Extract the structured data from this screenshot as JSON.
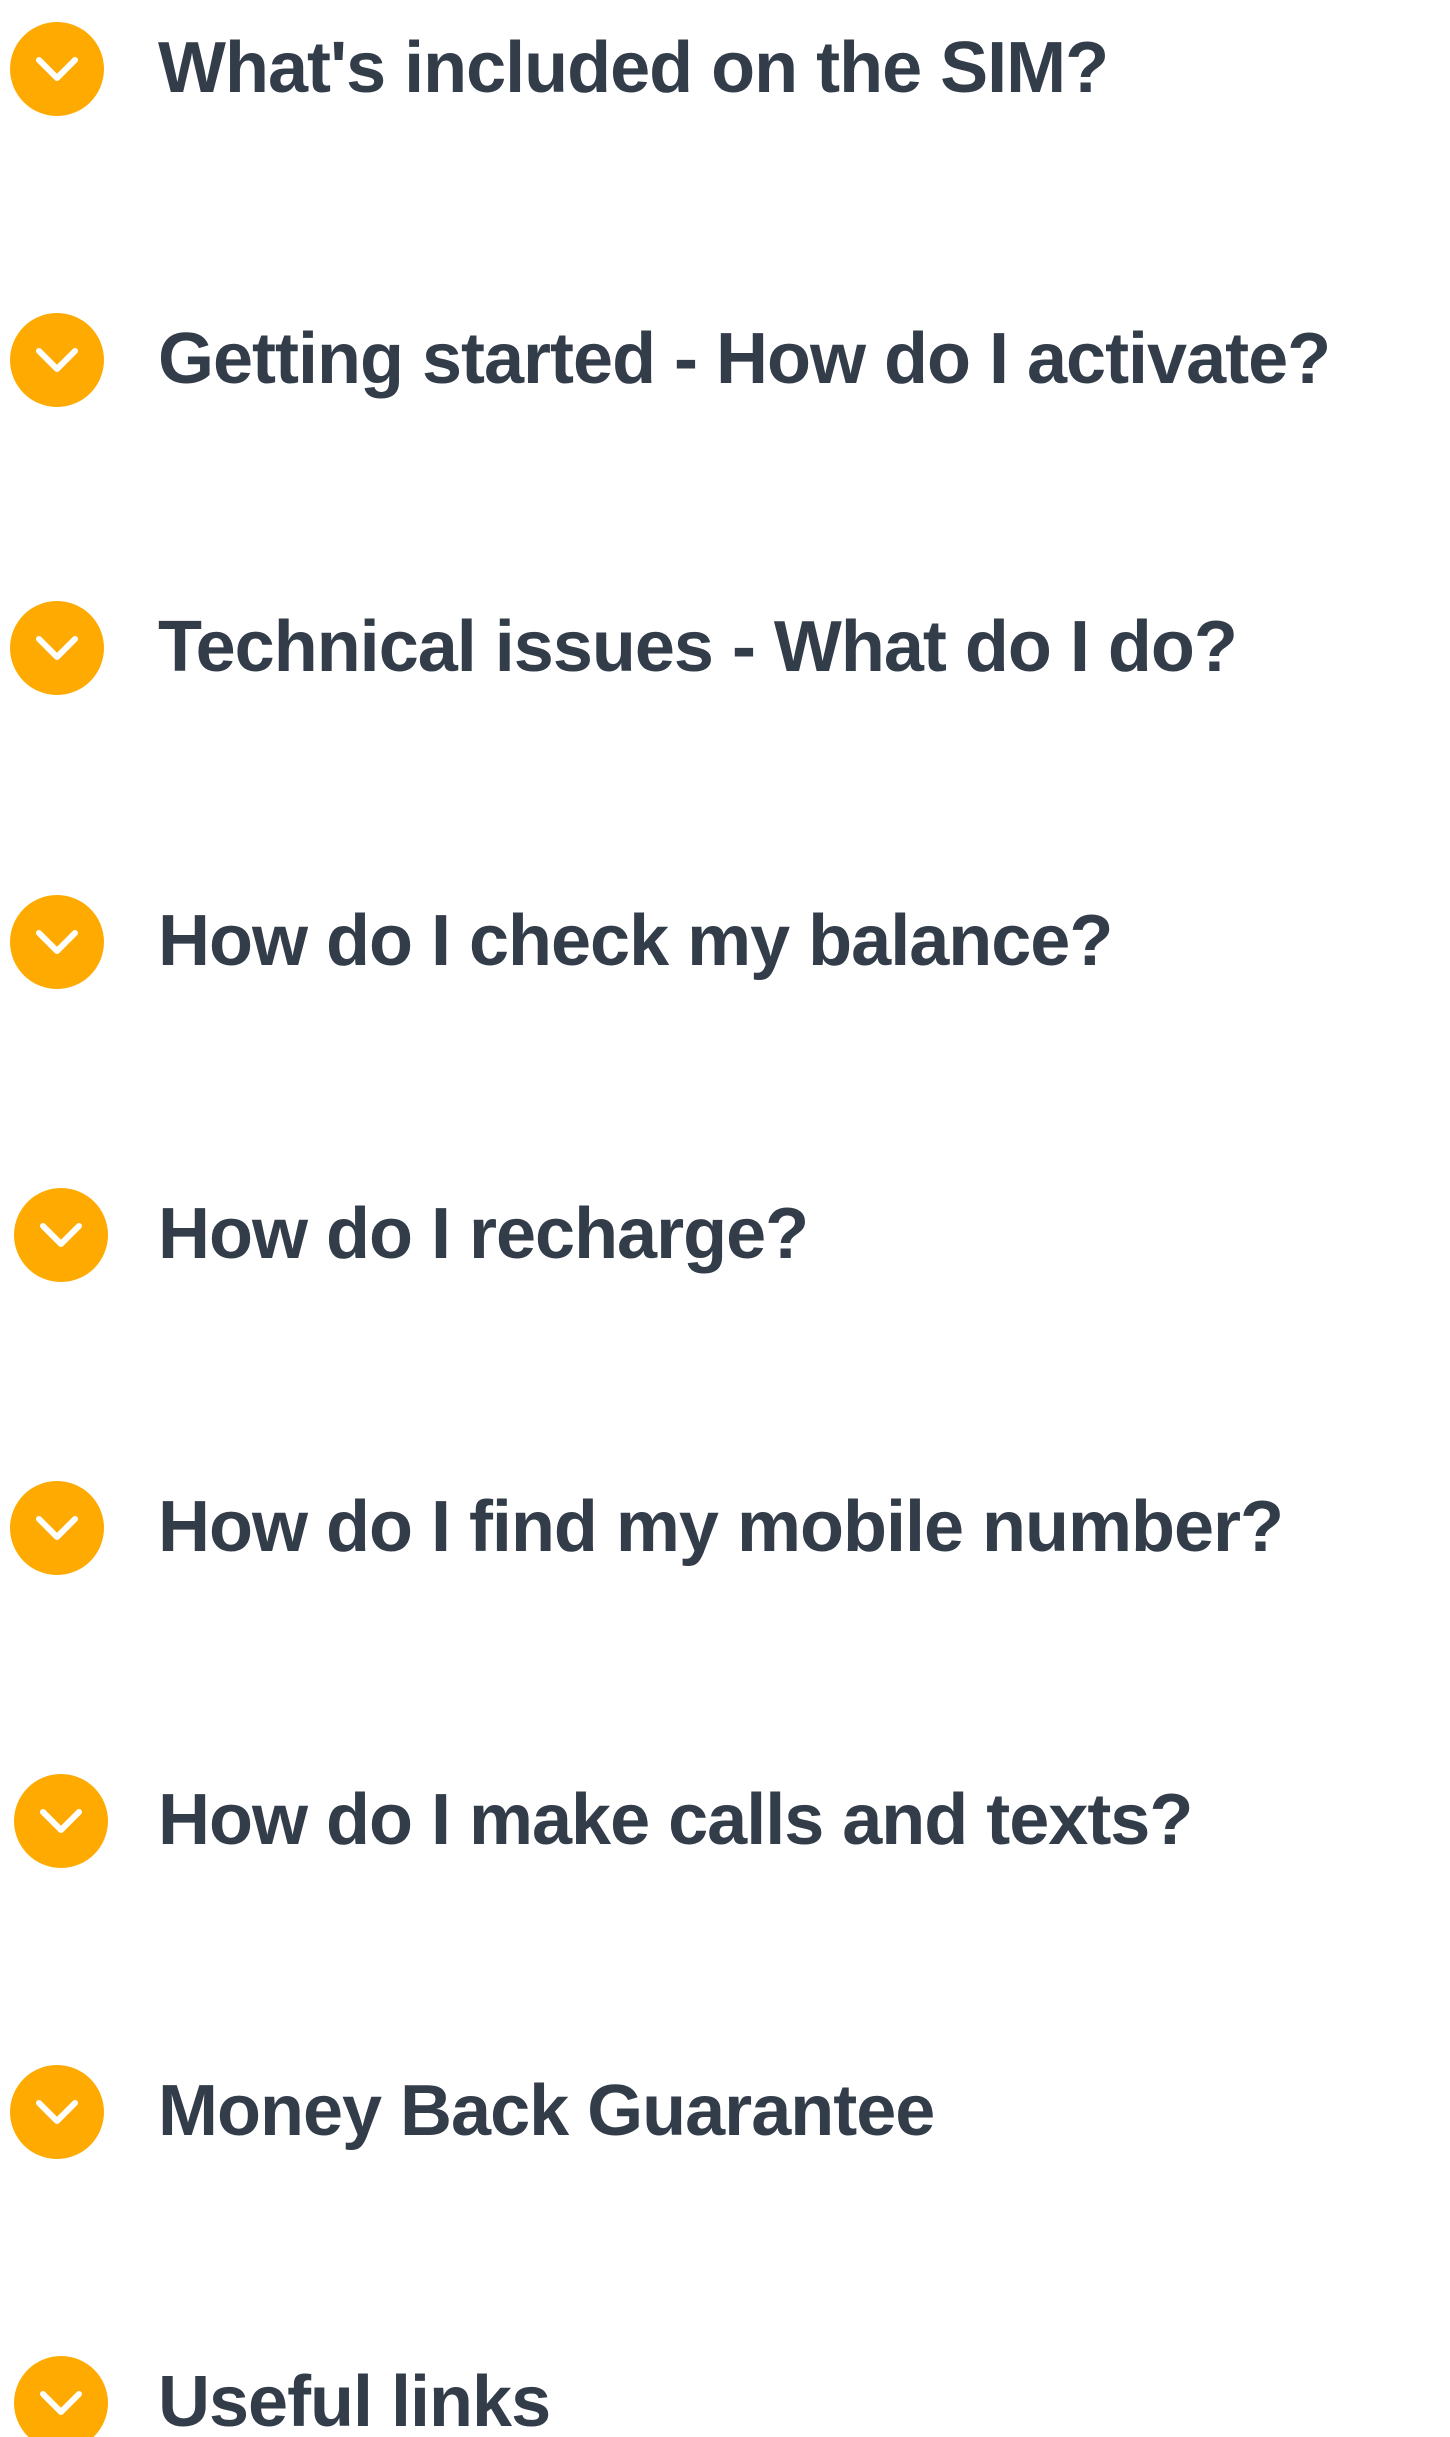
{
  "accent_color": "#FFAA00",
  "text_color": "#333D4A",
  "faq": {
    "items": [
      {
        "label": "What's included on the SIM?",
        "icon": "chevron-down-icon"
      },
      {
        "label": "Getting started - How do I activate?",
        "icon": "chevron-down-icon"
      },
      {
        "label": "Technical issues - What do I do?",
        "icon": "chevron-down-icon"
      },
      {
        "label": "How do I check my balance?",
        "icon": "chevron-down-icon"
      },
      {
        "label": "How do I recharge?",
        "icon": "chevron-down-icon"
      },
      {
        "label": "How do I find my mobile number?",
        "icon": "chevron-down-icon"
      },
      {
        "label": "How do I make calls and texts?",
        "icon": "chevron-down-icon"
      },
      {
        "label": "Money Back Guarantee",
        "icon": "chevron-down-icon"
      },
      {
        "label": "Useful links",
        "icon": "chevron-down-icon"
      }
    ]
  }
}
